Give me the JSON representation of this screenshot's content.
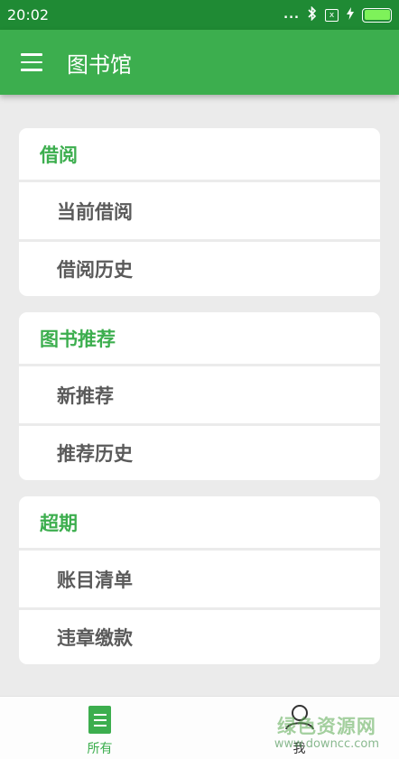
{
  "status_bar": {
    "time": "20:02",
    "dots": "...",
    "sim": "x"
  },
  "app_bar": {
    "title": "图书馆"
  },
  "sections": [
    {
      "header": "借阅",
      "items": [
        "当前借阅",
        "借阅历史"
      ]
    },
    {
      "header": "图书推荐",
      "items": [
        "新推荐",
        "推荐历史"
      ]
    },
    {
      "header": "超期",
      "items": [
        "账目清单",
        "违章缴款"
      ]
    }
  ],
  "bottom_nav": {
    "all_label": "所有",
    "me_label": "我"
  },
  "watermark": {
    "top": "绿色资源网",
    "bottom": "www.downcc.com"
  },
  "colors": {
    "primary": "#3cae4e",
    "status_bar": "#1f8a34",
    "battery": "#7ef25a"
  }
}
